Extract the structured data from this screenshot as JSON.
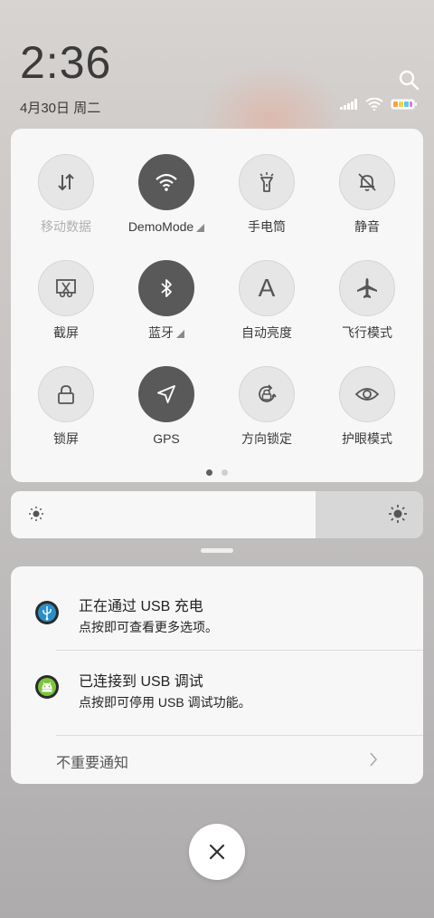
{
  "status": {
    "time": "2:36",
    "date": "4月30日 周二"
  },
  "quick_settings": {
    "tiles": [
      {
        "label": "移动数据",
        "state": "off",
        "icon": "mobile-data-icon",
        "dim": true
      },
      {
        "label": "DemoMode",
        "state": "on",
        "icon": "wifi-icon",
        "expand": true
      },
      {
        "label": "手电筒",
        "state": "off",
        "icon": "flashlight-icon"
      },
      {
        "label": "静音",
        "state": "off",
        "icon": "mute-bell-icon"
      },
      {
        "label": "截屏",
        "state": "off",
        "icon": "screenshot-icon"
      },
      {
        "label": "蓝牙",
        "state": "on",
        "icon": "bluetooth-icon",
        "expand": true
      },
      {
        "label": "自动亮度",
        "state": "off",
        "icon": "auto-brightness-icon",
        "glyph": "A"
      },
      {
        "label": "飞行模式",
        "state": "off",
        "icon": "airplane-icon"
      },
      {
        "label": "锁屏",
        "state": "off",
        "icon": "lock-icon"
      },
      {
        "label": "GPS",
        "state": "on",
        "icon": "location-arrow-icon"
      },
      {
        "label": "方向锁定",
        "state": "off",
        "icon": "rotation-lock-icon"
      },
      {
        "label": "护眼模式",
        "state": "off",
        "icon": "eye-icon"
      }
    ],
    "page_count": 2,
    "current_page": 1
  },
  "brightness": {
    "level": 0.74
  },
  "notifications": [
    {
      "title": "正在通过 USB 充电",
      "text": "点按即可查看更多选项。",
      "icon": "usb-icon"
    },
    {
      "title": "已连接到 USB 调试",
      "text": "点按即可停用 USB 调试功能。",
      "icon": "android-debug-icon"
    }
  ],
  "minor_notifications_label": "不重要通知",
  "colors": {
    "tile_on": "#595959",
    "tile_off": "#e6e6e6",
    "panel": "#f7f7f7",
    "usb_icon": "#2a8fc8",
    "debug_icon": "#7cc53a"
  }
}
